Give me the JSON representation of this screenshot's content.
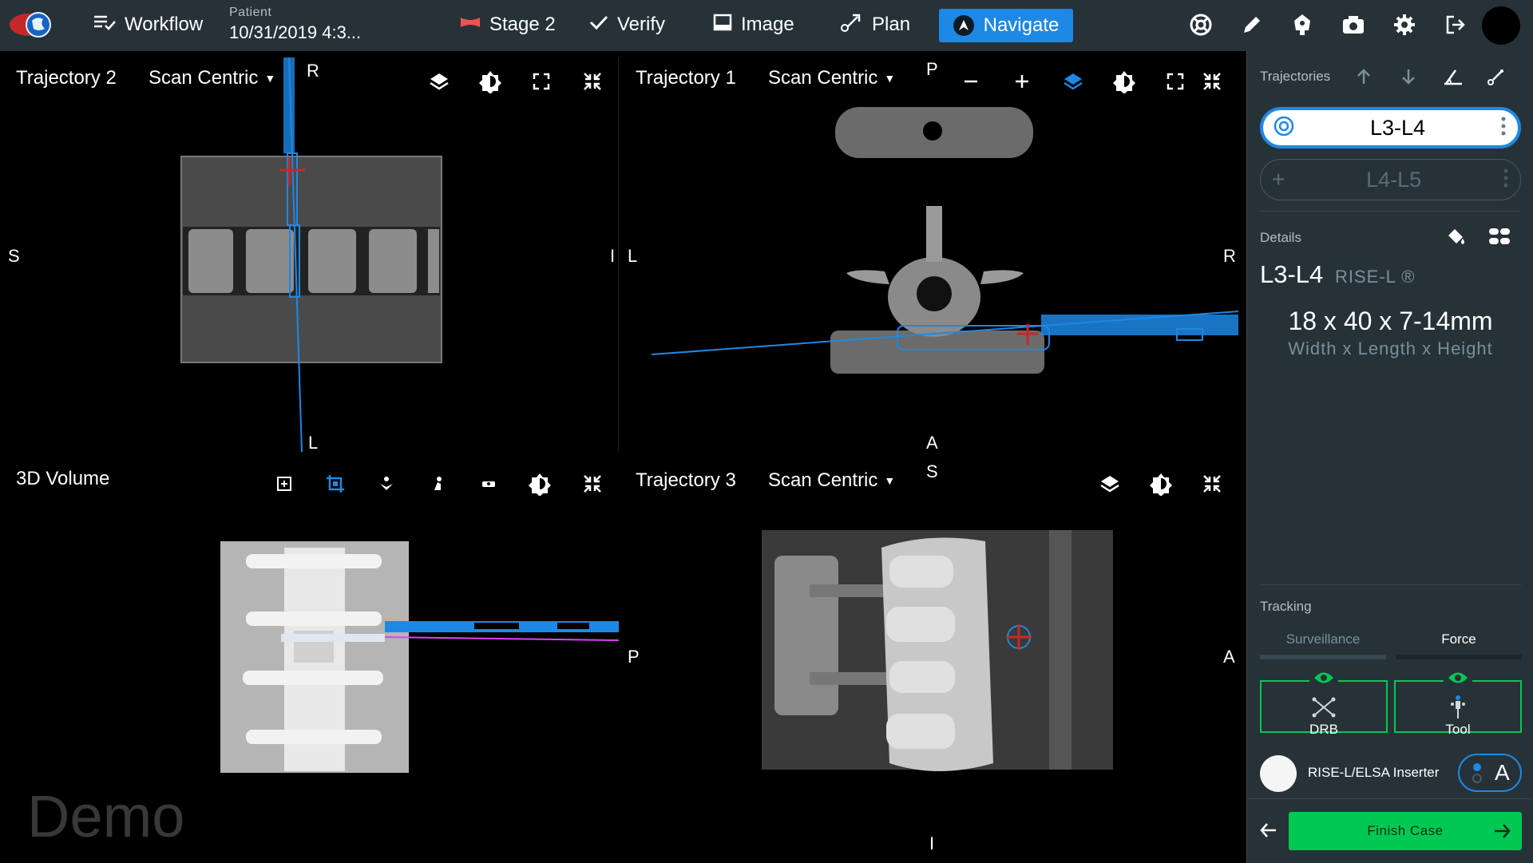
{
  "topbar": {
    "workflow_label": "Workflow",
    "patient_label": "Patient",
    "patient_value": "10/31/2019 4:3...",
    "stage_label": "Stage 2",
    "tabs": [
      {
        "label": "Verify"
      },
      {
        "label": "Image"
      },
      {
        "label": "Plan"
      },
      {
        "label": "Navigate"
      }
    ],
    "active_tab": "Navigate",
    "accent_color": "#1e88e5"
  },
  "viewports": {
    "tl": {
      "title": "Trajectory 2",
      "mode": "Scan Centric",
      "top": "R",
      "bottom": "L",
      "left": "S",
      "right": "I"
    },
    "tr": {
      "title": "Trajectory 1",
      "mode": "Scan Centric",
      "top": "P",
      "bottom": "A",
      "left": "L",
      "right": "R"
    },
    "bl": {
      "title": "3D Volume"
    },
    "br": {
      "title": "Trajectory 3",
      "mode": "Scan Centric",
      "top": "S",
      "bottom": "I",
      "left": "P",
      "right": "A"
    }
  },
  "panel": {
    "trajectories_label": "Trajectories",
    "trajectories": [
      {
        "name": "L3-L4",
        "active": true
      },
      {
        "name": "L4-L5",
        "active": false
      }
    ],
    "details_label": "Details",
    "details_title": "L3-L4",
    "details_implant": "RISE-L ®",
    "dimensions": "18 x 40 x 7-14mm",
    "dimensions_caption": "Width x Length x Height",
    "tracking_label": "Tracking",
    "tracking_tabs": [
      {
        "label": "Surveillance",
        "active": false
      },
      {
        "label": "Force",
        "active": true
      }
    ],
    "trackers": [
      {
        "label": "DRB",
        "status_color": "#00c853"
      },
      {
        "label": "Tool",
        "status_color": "#00c853"
      }
    ],
    "inserter_label": "RISE-L/ELSA Inserter",
    "mode_letter": "A",
    "finish_label": "Finish Case",
    "finish_color": "#00c853"
  },
  "watermark": "Demo"
}
